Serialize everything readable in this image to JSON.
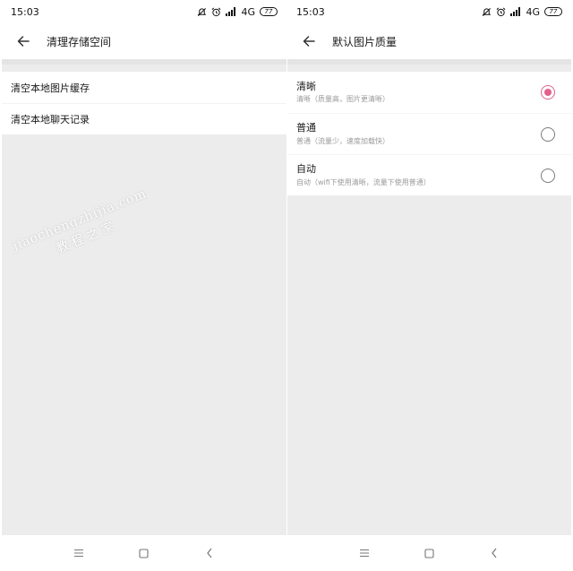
{
  "left_screen": {
    "status": {
      "time": "15:03",
      "network": "4G",
      "battery": "77"
    },
    "header": {
      "title": "清理存储空间"
    },
    "list": [
      {
        "label": "清空本地图片缓存"
      },
      {
        "label": "清空本地聊天记录"
      }
    ]
  },
  "right_screen": {
    "status": {
      "time": "15:03",
      "network": "4G",
      "battery": "77"
    },
    "header": {
      "title": "默认图片质量"
    },
    "options": [
      {
        "title": "清晰",
        "subtitle": "清晰（质量高，图片更清晰）",
        "selected": true
      },
      {
        "title": "普通",
        "subtitle": "普通（流量少，速度加载快）",
        "selected": false
      },
      {
        "title": "自动",
        "subtitle": "自动（wifi下使用清晰，流量下使用普通）",
        "selected": false
      }
    ]
  },
  "watermark": {
    "latin": "jiaochengzhijia.com",
    "chinese": "教程之家"
  },
  "colors": {
    "accent": "#e3608e",
    "page_background": "#ececec",
    "surface": "#ffffff"
  }
}
